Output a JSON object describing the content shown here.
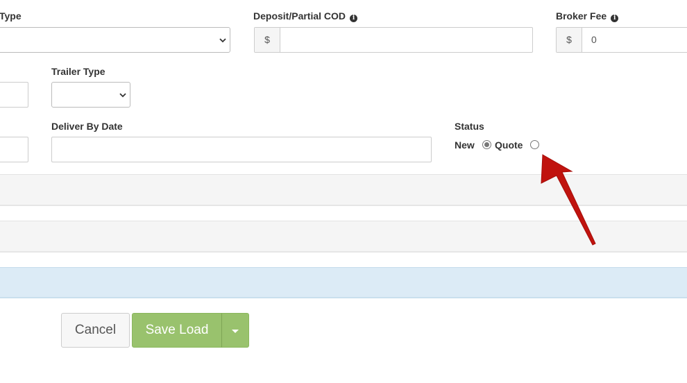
{
  "form": {
    "type_label_partial": "Type",
    "deposit_label": "Deposit/Partial COD",
    "broker_fee_label": "Broker Fee",
    "currency_symbol": "$",
    "deposit_value": "",
    "broker_fee_value": "0",
    "trailer_type_label": "Trailer Type",
    "trailer_type_value": "",
    "deliver_by_label": "Deliver By Date",
    "deliver_by_value": "",
    "status_label": "Status",
    "status_options": [
      {
        "label": "New",
        "selected": true
      },
      {
        "label": "Quote",
        "selected": false
      }
    ]
  },
  "actions": {
    "cancel_label": "Cancel",
    "save_label": "Save Load"
  },
  "colors": {
    "save_button": "#99c26d",
    "annotation_arrow": "#c0130e",
    "blue_band": "#dcebf6"
  },
  "icons": {
    "info": "info-icon",
    "chevron": "chevron-down-icon",
    "caret": "caret-down-icon",
    "arrow": "annotation-arrow-icon"
  }
}
